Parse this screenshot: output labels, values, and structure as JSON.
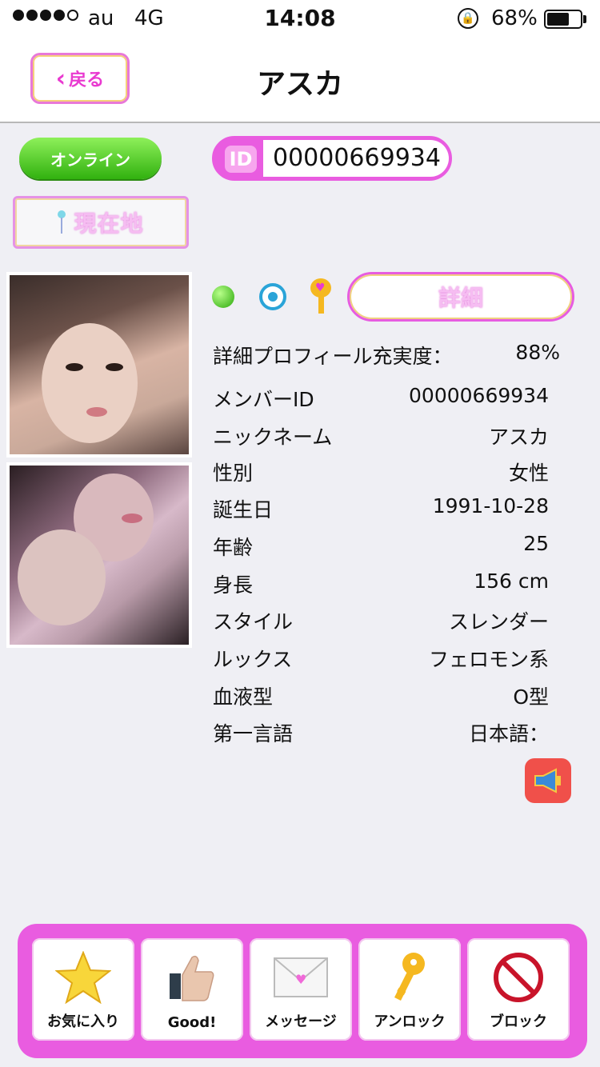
{
  "status_bar": {
    "carrier": "au",
    "network": "4G",
    "time": "14:08",
    "battery_percent": "68%",
    "battery_level": 0.68,
    "signal_bars_filled": 4,
    "signal_bars_total": 5
  },
  "nav": {
    "back_label": "戻る",
    "title": "アスカ"
  },
  "profile": {
    "online_status": "オンライン",
    "location_label": "現在地",
    "id_tag": "ID",
    "id_value": "00000669934",
    "detail_button": "詳細",
    "fill_rate_label": "詳細プロフィール充実度：",
    "fill_rate_value": "88%"
  },
  "info": [
    {
      "label": "メンバーID",
      "value": "00000669934"
    },
    {
      "label": "ニックネーム",
      "value": "アスカ"
    },
    {
      "label": "性別",
      "value": "女性"
    },
    {
      "label": "誕生日",
      "value": "1991-10-28"
    },
    {
      "label": "年齢",
      "value": "25"
    },
    {
      "label": "身長",
      "value": "156 cm"
    },
    {
      "label": "スタイル",
      "value": "スレンダー"
    },
    {
      "label": "ルックス",
      "value": "フェロモン系"
    },
    {
      "label": "血液型",
      "value": "O型"
    },
    {
      "label": "第一言語",
      "value": "日本語："
    }
  ],
  "toolbar": {
    "favorite": "お気に入り",
    "good": "Good!",
    "message": "メッセージ",
    "unlock": "アンロック",
    "block": "ブロック"
  },
  "icons": {
    "online_dot": "green-dot-icon",
    "target": "target-icon",
    "key": "key-icon",
    "report": "megaphone-icon"
  },
  "colors": {
    "accent_pink": "#e95ce0",
    "online_green": "#31b10f",
    "report_red": "#f0504a"
  }
}
